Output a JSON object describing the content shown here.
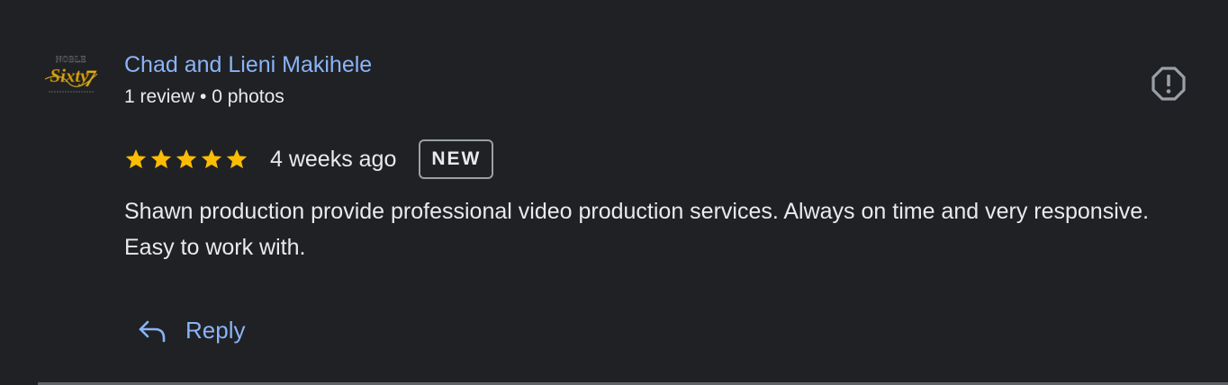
{
  "reviewer": {
    "name": "Chad and Lieni Makihele",
    "meta": "1 review • 0 photos",
    "avatar_text": "NOBLE Sixty7"
  },
  "review": {
    "rating": 5,
    "rating_max": 5,
    "date": "4 weeks ago",
    "badge": "NEW",
    "text": "Shawn production provide professional video production services. Always on time and very responsive. Easy to work with."
  },
  "actions": {
    "reply_label": "Reply",
    "reply_icon": "reply-arrow-icon",
    "report_icon": "report-octagon-icon"
  },
  "colors": {
    "background": "#202124",
    "link": "#8ab4f8",
    "text": "#e8eaed",
    "star": "#fbbc04",
    "icon_gray": "#9aa0a6"
  }
}
